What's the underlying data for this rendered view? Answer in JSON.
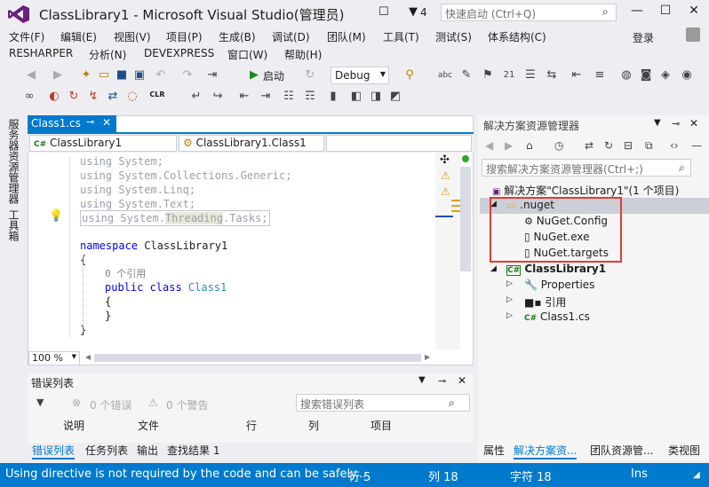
{
  "window": {
    "title": "ClassLibrary1 - Microsoft Visual Studio(管理员)",
    "notif_count": "4",
    "quicklaunch_placeholder": "快速启动 (Ctrl+Q)",
    "login": "登录"
  },
  "menu": {
    "row1": [
      "文件(F)",
      "编辑(E)",
      "视图(V)",
      "项目(P)",
      "生成(B)",
      "调试(D)",
      "团队(M)",
      "工具(T)",
      "测试(S)",
      "体系结构(C)"
    ],
    "row2": [
      "RESHARPER",
      "分析(N)",
      "DEVEXPRESS",
      "窗口(W)",
      "帮助(H)"
    ]
  },
  "toolbar": {
    "start_label": "启动",
    "config": "Debug",
    "clr_label": "CLR"
  },
  "left_tabs": {
    "server_explorer": "服务器资源管理器",
    "toolbox": "工具箱"
  },
  "editor": {
    "tab_label": "Class1.cs",
    "nav_project": "ClassLibrary1",
    "nav_class": "ClassLibrary1.Class1",
    "zoom": "100 %",
    "lines": {
      "u1a": "using",
      "u1b": " System;",
      "u2a": "using",
      "u2b": " System.Collections.Generic;",
      "u3a": "using",
      "u3b": " System.Linq;",
      "u4a": "using",
      "u4b": " System.Text;",
      "u5a": "using",
      "u5b": " System.",
      "u5c": "Threading",
      "u5d": ".Tasks;",
      "ns_kw": "namespace",
      "ns_name": " ClassLibrary1",
      "brace_open": "{",
      "refs": "0 个引用",
      "cls_kw": "public class",
      "cls_name": " Class1",
      "inner_open": "{",
      "inner_close": "}",
      "brace_close": "}"
    }
  },
  "error_list": {
    "title": "错误列表",
    "errors": "0 个错误",
    "warnings": "0 个警告",
    "search_placeholder": "搜索错误列表",
    "columns": [
      "说明",
      "文件",
      "行",
      "列",
      "项目"
    ]
  },
  "bottom_tabs": [
    "错误列表",
    "任务列表",
    "输出",
    "查找结果 1"
  ],
  "solution_explorer": {
    "title": "解决方案资源管理器",
    "search_placeholder": "搜索解决方案资源管理器(Ctrl+;)",
    "solution": "解决方案\"ClassLibrary1\"(1 个项目)",
    "nuget_folder": ".nuget",
    "nuget_files": [
      "NuGet.Config",
      "NuGet.exe",
      "NuGet.targets"
    ],
    "project": "ClassLibrary1",
    "project_items": [
      "Properties",
      "引用",
      "Class1.cs"
    ],
    "highlight_color": "#e03c31"
  },
  "right_bottom_tabs": [
    "属性",
    "解决方案资...",
    "团队资源管...",
    "类视图"
  ],
  "status": {
    "message": "Using directive is not required by the code and can be safely...",
    "line": "行 5",
    "col": "列 18",
    "char": "字符 18",
    "mode": "Ins"
  },
  "colors": {
    "accent": "#007acc",
    "vs_purple": "#68217a"
  }
}
